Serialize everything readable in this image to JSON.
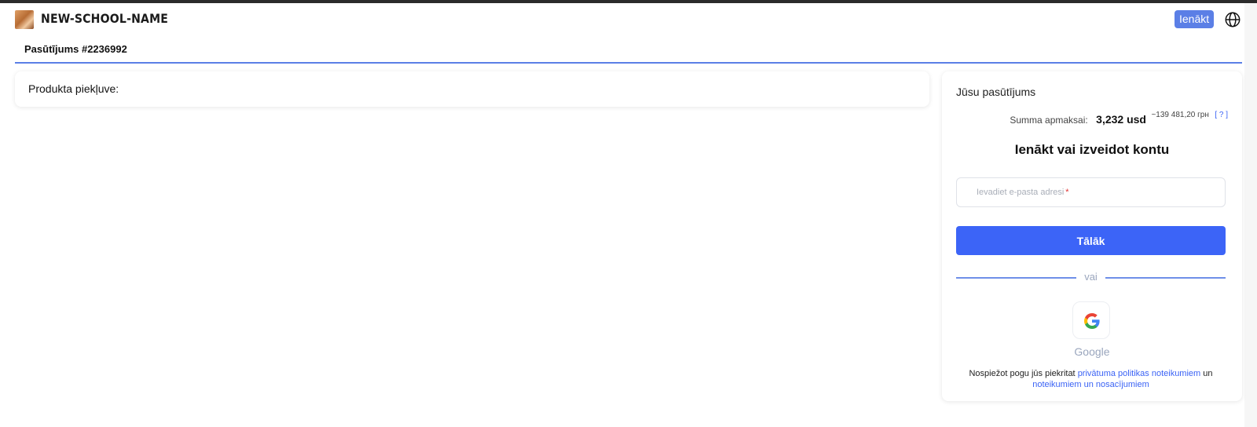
{
  "header": {
    "school_name": "NEW-SCHOOL-NAME",
    "login_label": "Ienākt"
  },
  "tabs": {
    "order_label": "Pasūtījums #2236992"
  },
  "product_access": {
    "label": "Produkta piekļuve:"
  },
  "order_panel": {
    "title": "Jūsu pasūtījums",
    "sum_label": "Summa apmaksai:",
    "sum_value": "3,232 usd",
    "sum_approx": "~139 481,20 грн",
    "sum_help": "[ ? ]",
    "auth_heading": "Ienākt vai izveidot kontu",
    "email_placeholder": "Ievadiet e-pasta adresi",
    "required_mark": "*",
    "next_label": "Tālāk",
    "divider_text": "vai",
    "google_label": "Google",
    "legal_prefix": "Nospiežot pogu jūs piekritat",
    "privacy_link": "privātuma politikas noteikumiem",
    "legal_and": "un",
    "terms_link": "noteikumiem un nosacījumiem"
  },
  "colors": {
    "accent": "#5b7fe6",
    "primary_button": "#3c64f7",
    "link": "#3b63f5"
  }
}
